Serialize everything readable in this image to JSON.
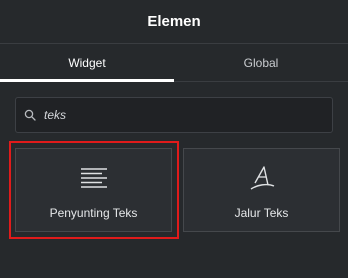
{
  "header": {
    "title": "Elemen"
  },
  "tabs": [
    {
      "label": "Widget",
      "active": true
    },
    {
      "label": "Global",
      "active": false
    }
  ],
  "search": {
    "value": "teks",
    "icon": "search-icon"
  },
  "widgets": [
    {
      "label": "Penyunting Teks",
      "icon": "text-editor-icon",
      "highlighted": true
    },
    {
      "label": "Jalur Teks",
      "icon": "text-path-icon",
      "highlighted": false
    }
  ],
  "colors": {
    "background": "#26292c",
    "card": "#2c2f33",
    "highlight": "#e01b1b",
    "active_tab_indicator": "#ffffff"
  }
}
